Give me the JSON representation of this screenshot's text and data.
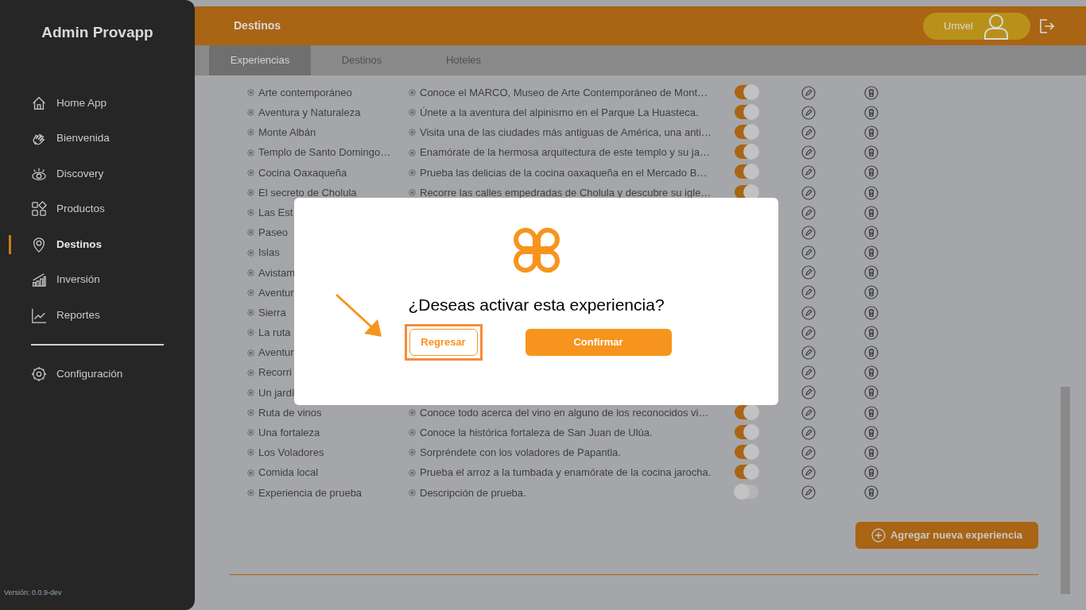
{
  "sidebar": {
    "title": "Admin Provapp",
    "items": [
      {
        "label": "Home App",
        "kind": "home",
        "selected": false
      },
      {
        "label": "Bienvenida",
        "kind": "hand",
        "selected": false
      },
      {
        "label": "Discovery",
        "kind": "eye",
        "selected": false
      },
      {
        "label": "Productos",
        "kind": "grid",
        "selected": false
      },
      {
        "label": "Destinos",
        "kind": "pin",
        "selected": true
      },
      {
        "label": "Inversión",
        "kind": "bars",
        "selected": false
      },
      {
        "label": "Reportes",
        "kind": "chart",
        "selected": false
      }
    ],
    "footer_items": [
      {
        "label": "Configuración",
        "kind": "gear",
        "selected": false
      }
    ],
    "version": "Versión: 0.0.9-dev"
  },
  "header": {
    "title": "Destinos",
    "user": "Umvel"
  },
  "tabs": [
    {
      "label": "Experiencias",
      "selected": true
    },
    {
      "label": "Destinos",
      "selected": false
    },
    {
      "label": "Hoteles",
      "selected": false
    }
  ],
  "rows": [
    {
      "name": "Arte contemporáneo",
      "description": "Conoce el MARCO, Museo de Arte Contemporáneo de Mont…",
      "active": true
    },
    {
      "name": "Aventura y Naturaleza",
      "description": "Únete a la aventura del alpinismo en el Parque La Huasteca.",
      "active": true
    },
    {
      "name": "Monte Albán",
      "description": "Visita una de las ciudades más antiguas de América, una anti…",
      "active": true
    },
    {
      "name": "Templo de Santo Domingo…",
      "description": "Enamórate de la hermosa arquitectura de este templo y su ja…",
      "active": true
    },
    {
      "name": "Cocina Oaxaqueña",
      "description": "Prueba las delicias de la cocina oaxaqueña en el Mercado B…",
      "active": true
    },
    {
      "name": "El secreto de Cholula",
      "description": "Recorre las calles empedradas de Cholula y descubre su igle…",
      "active": true
    },
    {
      "name": "Las Est"
    },
    {
      "name": "Paseo"
    },
    {
      "name": "Islas"
    },
    {
      "name": "Avistam"
    },
    {
      "name": "Aventur"
    },
    {
      "name": "Sierra"
    },
    {
      "name": "La ruta"
    },
    {
      "name": "Aventur"
    },
    {
      "name": "Recorri"
    },
    {
      "name": "Un jardí"
    },
    {
      "name": "Ruta de vinos",
      "description": "Conoce todo acerca del vino en alguno de los reconocidos vi…",
      "active": true
    },
    {
      "name": "Una fortaleza",
      "description": "Conoce la histórica fortaleza de San Juan de Ulúa.",
      "active": true
    },
    {
      "name": "Los Voladores",
      "description": "Sorpréndete con los voladores de Papantla.",
      "active": true
    },
    {
      "name": "Comida local",
      "description": "Prueba el arroz a la tumbada y enamórate de la cocina jarocha.",
      "active": true
    },
    {
      "name": "Experiencia de prueba",
      "description": "Descripción de prueba.",
      "active": false
    }
  ],
  "add_button": "Agregar nueva experiencia",
  "modal": {
    "question": "¿Deseas activar esta experiencia?",
    "buttons": [
      {
        "label": "Regresar",
        "kind": "secondary",
        "highlighted": true
      },
      {
        "label": "Confirmar",
        "kind": "primary",
        "highlighted": false
      }
    ]
  }
}
